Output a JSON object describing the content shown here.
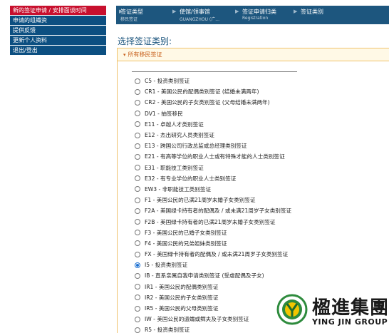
{
  "sidebar": {
    "items": [
      {
        "label": "新的签证申请 / 安排面谈时间",
        "active": true
      },
      {
        "label": "申请的组織资",
        "active": false
      },
      {
        "label": "提供反馈",
        "active": false
      },
      {
        "label": "更新个人资料",
        "active": false
      },
      {
        "label": "退出/登出",
        "active": false
      }
    ]
  },
  "breadcrumb": {
    "steps": [
      {
        "title": "签证类型",
        "subtitle": "移民签证"
      },
      {
        "title": "使馆/领事馆",
        "subtitle": "GUANGZHOU (广..."
      },
      {
        "title": "签证申请归类",
        "subtitle": "Registration"
      },
      {
        "title": "签证类别",
        "subtitle": ""
      }
    ]
  },
  "prompt": "选择签证类别:",
  "panel": {
    "header": "所有移民签证",
    "selected": "I5 - 投资类别签证",
    "options": [
      "C5 - 投资类别签证",
      "CR1 - 美国公民的配偶类别签证 (结婚未满两年)",
      "CR2 - 美国公民的子女类别签证 (父母结婚未满两年)",
      "DV1 - 抽签移民",
      "E11 - 卓越人才类别签证",
      "E12 - 杰出研究人员类别签证",
      "E13 - 跨国公司行政总监或总经理类别签证",
      "E21 - 有高等学位的职业人士或有特殊才能的人士类别签证",
      "E31 - 职能技工类别签证",
      "E32 - 有专业学位的职业人士类别签证",
      "EW3 - 非职能技工类别签证",
      "F1 - 美国公民的已满21周岁未婚子女类别签证",
      "F2A - 美国绿卡持有者的配偶及 / 或未满21周岁子女类别签证",
      "F2B - 美国绿卡持有者的已满21周岁未婚子女类别签证",
      "F3 - 美国公民的已婚子女类别签证",
      "F4 - 美国公民的兄弟姐妹类别签证",
      "FX - 美国绿卡持有者的配偶及 / 或未满21周岁子女类别签证",
      "I5 - 投资类别签证",
      "IB - 直系亲属自我申请类别签证 (受虐配偶及子女)",
      "IR1 - 美国公民的配偶类别签证",
      "IR2 - 美国公民的子女类别签证",
      "IR5 - 美国公民的父母类别签证",
      "IW - 美国公民的遗孀或鳏夫及子女类别签证",
      "R5 - 投资类别签证"
    ]
  },
  "logo": {
    "name_cn": "楹進集團",
    "name_en": "YING JIN GROUP",
    "colors": {
      "green": "#2e8b3d",
      "yellow": "#f2c500"
    }
  }
}
